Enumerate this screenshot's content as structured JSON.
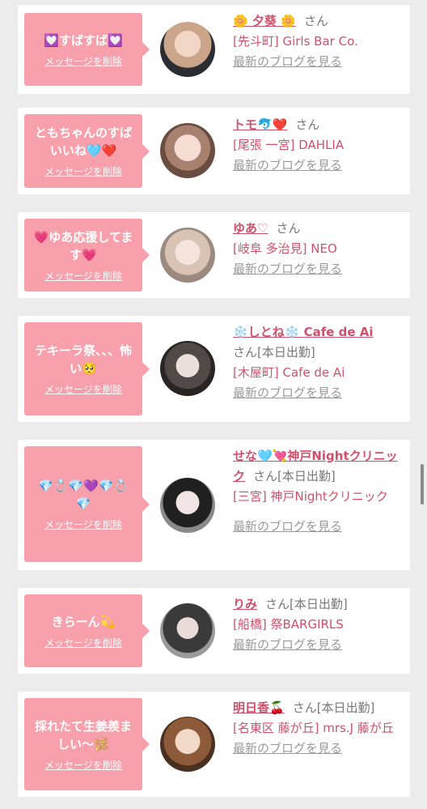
{
  "messages": [
    {
      "text": "💟すばすば💟",
      "delete": "メッセージを削除",
      "name": "🌼 夕葵 🌼",
      "san": "さん",
      "status": "",
      "shop": "[先斗町] Girls Bar Co.",
      "blog": "最新のブログを見る"
    },
    {
      "text": "ともちゃんのすばいいね🩵❤️",
      "delete": "メッセージを削除",
      "name": "トモ🐬❤️",
      "san": "さん",
      "status": "",
      "shop": "[尾張 一宮] DAHLIA",
      "blog": "最新のブログを見る"
    },
    {
      "text": "💗ゆあ応援してます💗",
      "delete": "メッセージを削除",
      "name": "ゆあ♡",
      "san": "さん",
      "status": "",
      "shop": "[岐阜 多治見] NEO",
      "blog": "最新のブログを見る"
    },
    {
      "text": "テキーラ祭、、、怖い🥺",
      "delete": "メッセージを削除",
      "name": "❄️しとね❄️ Cafe de Ai",
      "san": "さん",
      "status": "[本日出勤]",
      "shop": "[木屋町] Cafe de Ai",
      "blog": "最新のブログを見る"
    },
    {
      "text": "💎💍💎💜💎💍💎",
      "delete": "メッセージを削除",
      "name": "せな🩵💘神戸Nightクリニック",
      "san": "さん",
      "status": "[本日出勤]",
      "shop": "[三宮] 神戸Nightクリニック",
      "blog": "最新のブログを見る"
    },
    {
      "text": "きらーん💫",
      "delete": "メッセージを削除",
      "name": "りみ",
      "san": "さん",
      "status": "[本日出勤]",
      "shop": "[船橋] 祭BARGIRLS",
      "blog": "最新のブログを見る"
    },
    {
      "text": "採れたて生姜羨ましい〜🫚",
      "delete": "メッセージを削除",
      "name": "明日香🍒",
      "san": "さん",
      "status": "[本日出勤]",
      "shop": "[名東区 藤が丘] mrs.J 藤が丘",
      "blog": "最新のブログを見る"
    }
  ],
  "colors": {
    "accent": "#d0506c",
    "bubble": "#f7a0ab",
    "muted": "#999999"
  },
  "icons": {
    "avatar": "avatar-photo"
  }
}
